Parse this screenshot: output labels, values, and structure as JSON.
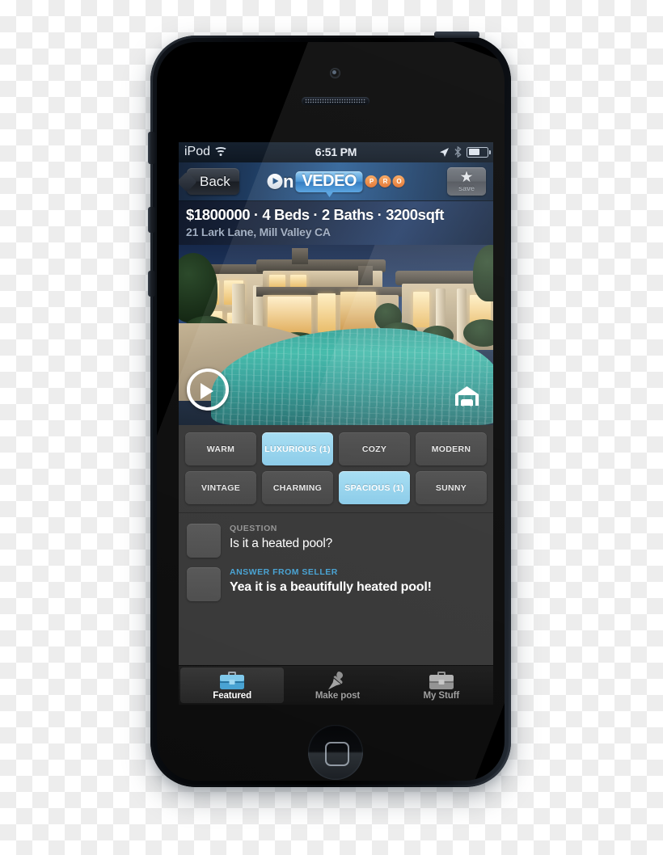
{
  "device": {
    "name": "iPod touch",
    "home_button": "home-button",
    "buttons": [
      "mute-switch",
      "volume-up",
      "volume-down",
      "power-button"
    ]
  },
  "status_bar": {
    "carrier": "iPod",
    "wifi_icon": "wifi-icon",
    "time": "6:51 PM",
    "location_icon": "location-arrow-icon",
    "bluetooth_icon": "bluetooth-icon",
    "battery_icon": "battery-icon",
    "battery_percent": 55
  },
  "nav_bar": {
    "back_label": "Back",
    "logo": {
      "on": "n",
      "o_play_icon": "play-icon",
      "bubble": "VEDEO",
      "pro": [
        "P",
        "R",
        "O"
      ]
    },
    "save": {
      "star_icon": "star-icon",
      "label": "save"
    }
  },
  "property": {
    "headline": "$1800000 · 4 Beds · 2 Baths · 3200sqft",
    "price": "$1800000",
    "beds": "4 Beds",
    "baths": "2 Baths",
    "size": "3200sqft",
    "address": "21 Lark Lane, Mill Valley CA"
  },
  "media": {
    "play_icon": "play-button-icon",
    "garage_icon": "garage-icon",
    "alt": "Luxury home exterior at dusk with swimming pool"
  },
  "tags": [
    {
      "label": "WARM",
      "selected": false
    },
    {
      "label": "LUXURIOUS (1)",
      "selected": true
    },
    {
      "label": "COZY",
      "selected": false
    },
    {
      "label": "MODERN",
      "selected": false
    },
    {
      "label": "VINTAGE",
      "selected": false
    },
    {
      "label": "CHARMING",
      "selected": false
    },
    {
      "label": "SPACIOUS (1)",
      "selected": true
    },
    {
      "label": "SUNNY",
      "selected": false
    }
  ],
  "qa": [
    {
      "kicker": "QUESTION",
      "text": "Is it a heated pool?"
    },
    {
      "kicker": "ANSWER FROM SELLER",
      "text": "Yea it is a beautifully heated pool!"
    }
  ],
  "tab_bar": [
    {
      "label": "Featured",
      "icon": "briefcase-icon",
      "active": true
    },
    {
      "label": "Make post",
      "icon": "pushpin-icon",
      "active": false
    },
    {
      "label": "My Stuff",
      "icon": "briefcase-icon",
      "active": false
    }
  ],
  "colors": {
    "accent_blue": "#85c9e8",
    "answer_blue": "#3f9ed1",
    "panel_dark": "#2e2e2e",
    "tag_dark": "#454545",
    "orange": "#e2702a"
  }
}
